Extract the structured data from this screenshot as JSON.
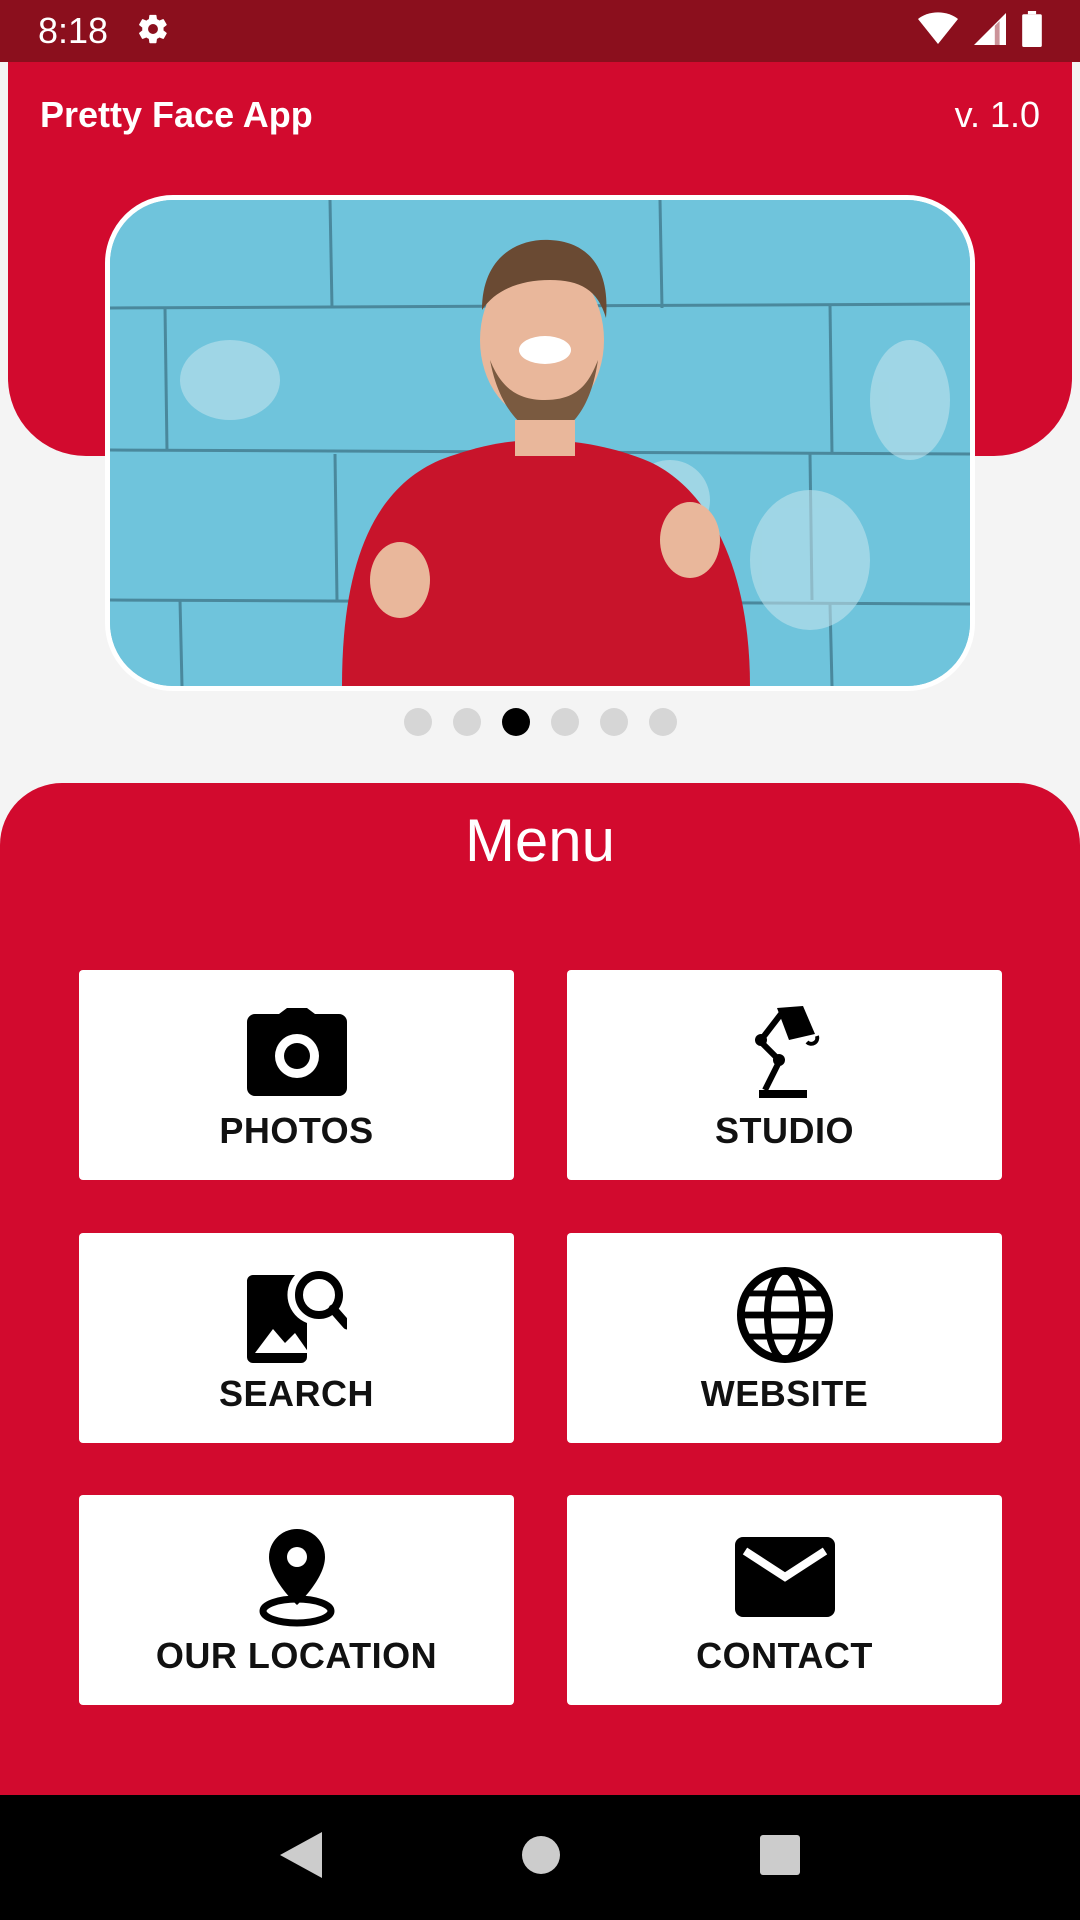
{
  "status_bar": {
    "time": "8:18",
    "icons": [
      "gear-icon",
      "wifi-icon",
      "signal-icon",
      "battery-icon"
    ]
  },
  "header": {
    "title": "Pretty Face App",
    "version": "v. 1.0",
    "background_color": "#d20a2e"
  },
  "carousel": {
    "image": "smiling man in red sweater in front of blue brick wall",
    "dots_total": 6,
    "active_index": 2
  },
  "menu": {
    "title": "Menu",
    "items": [
      {
        "label": "PHOTOS",
        "icon": "camera-icon"
      },
      {
        "label": "STUDIO",
        "icon": "desk-lamp-icon"
      },
      {
        "label": "SEARCH",
        "icon": "image-search-icon"
      },
      {
        "label": "WEBSITE",
        "icon": "globe-icon"
      },
      {
        "label": "OUR LOCATION",
        "icon": "location-pin-icon"
      },
      {
        "label": "CONTACT",
        "icon": "mail-icon"
      }
    ]
  },
  "nav_bar": {
    "icons": [
      "back-icon",
      "home-icon",
      "recents-icon"
    ]
  },
  "colors": {
    "status_bar": "#8b0f1d",
    "accent": "#d20a2e",
    "page_background": "#f4f4f4"
  }
}
